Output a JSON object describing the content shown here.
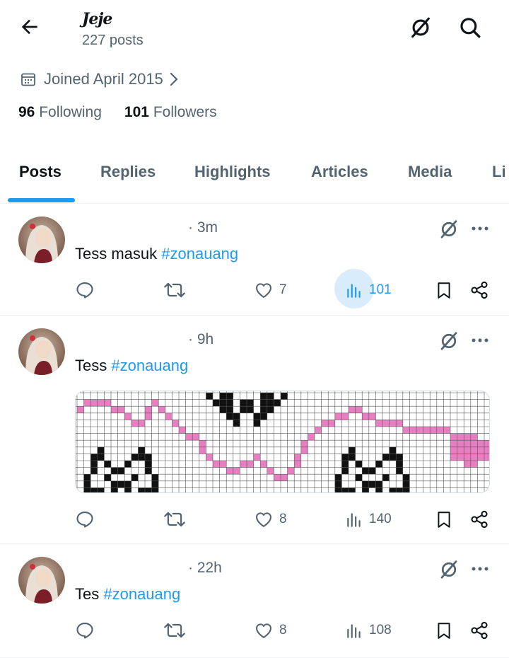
{
  "profile": {
    "name": "Jeje",
    "posts_count": "227 posts",
    "joined": "Joined April 2015",
    "following_count": "96",
    "following_label": "Following",
    "followers_count": "101",
    "followers_label": "Followers"
  },
  "tabs": [
    {
      "label": "Posts",
      "active": true
    },
    {
      "label": "Replies"
    },
    {
      "label": "Highlights"
    },
    {
      "label": "Articles"
    },
    {
      "label": "Media"
    },
    {
      "label": "Li"
    }
  ],
  "posts": [
    {
      "time": "· 3m",
      "text": "Tess masuk ",
      "hashtag": "#zonauang",
      "likes": "7",
      "views": "101",
      "views_highlighted": true
    },
    {
      "time": "· 9h",
      "text": "Tess ",
      "hashtag": "#zonauang",
      "has_media": true,
      "likes": "8",
      "views": "140"
    },
    {
      "time": "· 22h",
      "text": "Tes ",
      "hashtag": "#zonauang",
      "likes": "8",
      "views": "108"
    }
  ],
  "colors": {
    "accent": "#1d9bf0",
    "secondary_text": "#536471",
    "primary_text": "#0f1419",
    "pixel_pink": "#e77ec1"
  },
  "icons": [
    "back-arrow-icon",
    "grok-icon",
    "search-icon",
    "calendar-icon",
    "chevron-right-icon",
    "reply-icon",
    "repost-icon",
    "like-icon",
    "views-icon",
    "bookmark-icon",
    "share-icon",
    "more-icon"
  ]
}
